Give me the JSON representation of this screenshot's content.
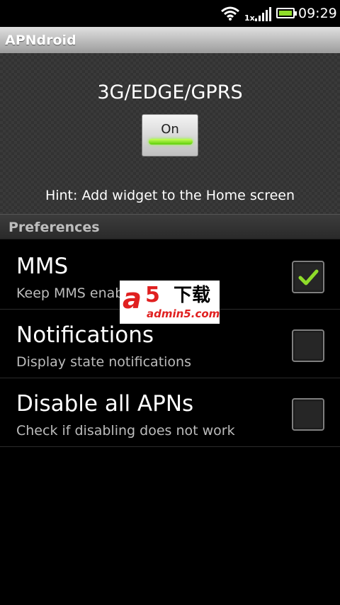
{
  "status_bar": {
    "network_tag": "1x",
    "time": "09:29",
    "battery_level": 1.0,
    "icons": [
      "wifi-icon",
      "signal-icon",
      "battery-icon"
    ]
  },
  "app": {
    "title": "APNdroid"
  },
  "header": {
    "mode_title": "3G/EDGE/GPRS",
    "toggle_label": "On",
    "toggle_state": "on",
    "hint": "Hint: Add widget to the Home screen"
  },
  "preferences": {
    "section_label": "Preferences",
    "items": [
      {
        "title": "MMS",
        "summary": "Keep MMS enabled",
        "checked": true
      },
      {
        "title": "Notifications",
        "summary": "Display state notifications",
        "checked": false
      },
      {
        "title": "Disable all APNs",
        "summary": "Check if disabling does not work",
        "checked": false
      }
    ]
  },
  "watermark": {
    "brand_a": "a",
    "brand_5": "5",
    "brand_cn": "下载",
    "domain": "admin5.com"
  },
  "colors": {
    "accent_green": "#8fdc2a",
    "title_bar": "#b4b4b4",
    "background": "#000000"
  }
}
